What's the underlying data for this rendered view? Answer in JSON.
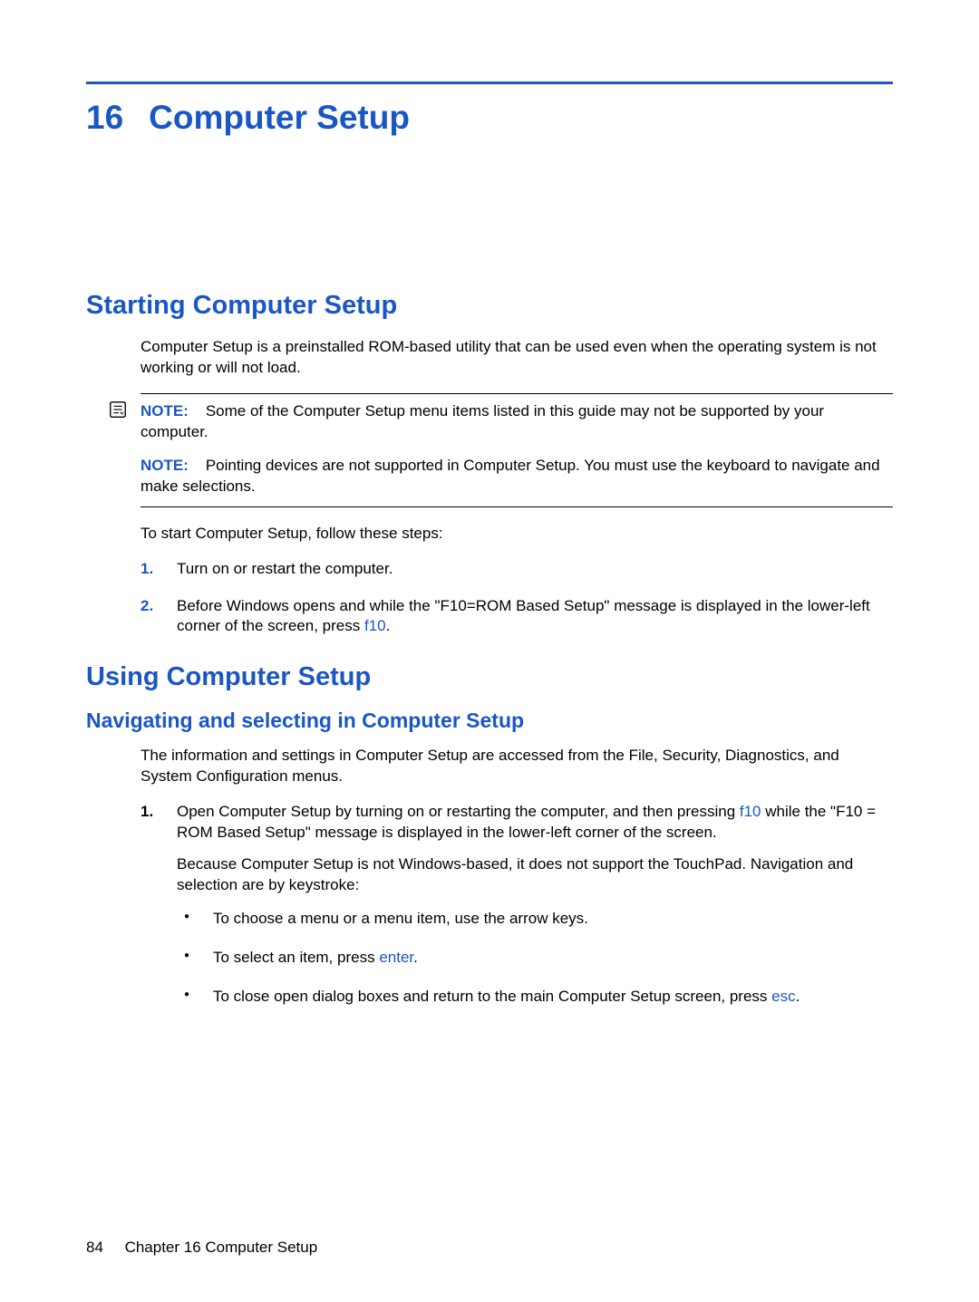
{
  "chapter": {
    "number": "16",
    "title": "Computer Setup"
  },
  "section1": {
    "heading": "Starting Computer Setup",
    "intro": "Computer Setup is a preinstalled ROM-based utility that can be used even when the operating system is not working or will not load.",
    "note1_label": "NOTE:",
    "note1_text": "Some of the Computer Setup menu items listed in this guide may not be supported by your computer.",
    "note2_label": "NOTE:",
    "note2_text": "Pointing devices are not supported in Computer Setup. You must use the keyboard to navigate and make selections.",
    "steps_intro": "To start Computer Setup, follow these steps:",
    "step1_marker": "1.",
    "step1_text": "Turn on or restart the computer.",
    "step2_marker": "2.",
    "step2_text_a": "Before Windows opens and while the \"F10=ROM Based Setup\" message is displayed in the lower-left corner of the screen, press ",
    "step2_key": "f10",
    "step2_text_b": "."
  },
  "section2": {
    "heading": "Using Computer Setup",
    "sub1": "Navigating and selecting in Computer Setup",
    "intro": "The information and settings in Computer Setup are accessed from the File, Security, Diagnostics, and System Configuration menus.",
    "step1_marker": "1.",
    "step1_text_a": "Open Computer Setup by turning on or restarting the computer, and then pressing ",
    "step1_key": "f10",
    "step1_text_b": " while the \"F10 = ROM Based Setup\" message is displayed in the lower-left corner of the screen.",
    "step1_para2": "Because Computer Setup is not Windows-based, it does not support the TouchPad. Navigation and selection are by keystroke:",
    "bullet1": "To choose a menu or a menu item, use the arrow keys.",
    "bullet2_a": "To select an item, press ",
    "bullet2_key": "enter",
    "bullet2_b": ".",
    "bullet3_a": "To close open dialog boxes and return to the main Computer Setup screen, press ",
    "bullet3_key": "esc",
    "bullet3_b": "."
  },
  "footer": {
    "page": "84",
    "label": "Chapter 16   Computer Setup"
  }
}
